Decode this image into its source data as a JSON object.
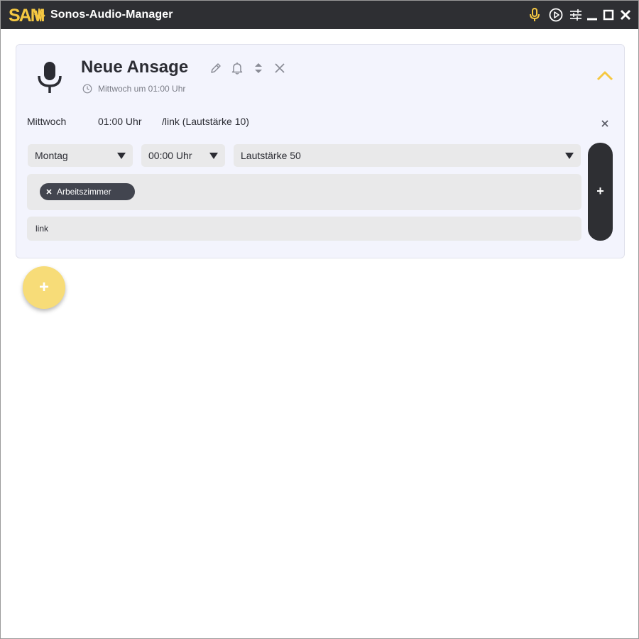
{
  "app": {
    "logo_text": "SAM",
    "title": "Sonos-Audio-Manager",
    "accent_color": "#f5c842",
    "titlebar_color": "#2e2f33"
  },
  "titlebar": {
    "icons": [
      "microphone-icon",
      "play-circle-icon",
      "sliders-icon",
      "minimize-icon",
      "maximize-icon",
      "close-icon"
    ]
  },
  "card": {
    "icon": "microphone-icon",
    "title": "Neue Ansage",
    "subtitle": "Mittwoch um 01:00 Uhr",
    "header_actions": [
      "edit-icon",
      "bell-icon",
      "reorder-icon",
      "delete-icon"
    ],
    "collapse_icon": "chevron-up-icon",
    "schedule": {
      "day": "Mittwoch",
      "time": "01:00 Uhr",
      "action": "/link (Lautstärke 10)"
    },
    "form": {
      "day_select": "Montag",
      "time_select": "00:00 Uhr",
      "volume_select": "Lautstärke 50",
      "rooms": [
        "Arbeitszimmer"
      ],
      "link_value": "link",
      "add_label": "+"
    }
  },
  "fab": {
    "label": "+"
  }
}
